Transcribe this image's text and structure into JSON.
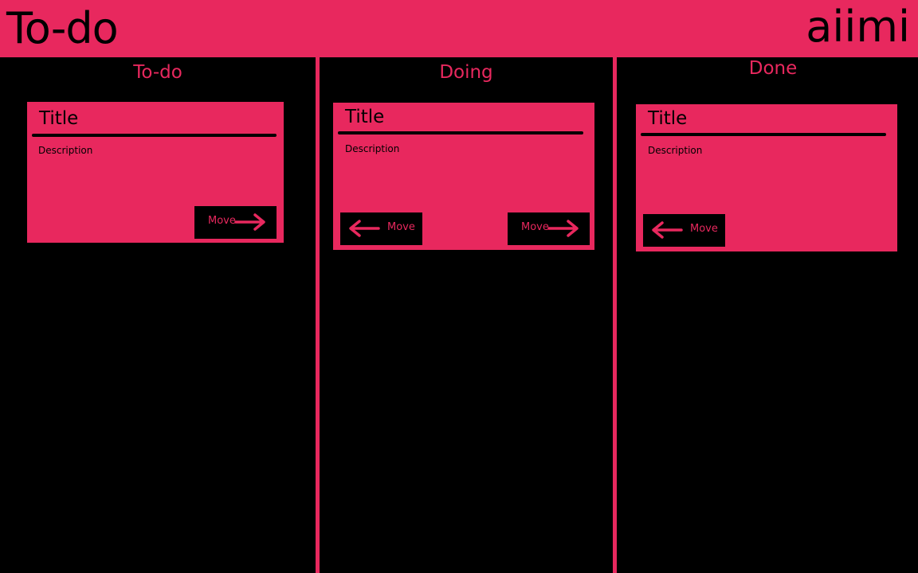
{
  "header": {
    "title": "To-do",
    "brand": "aiimi"
  },
  "colors": {
    "accent": "#e8285e",
    "background": "#000000"
  },
  "columns": [
    {
      "heading": "To-do",
      "card": {
        "title": "Title",
        "description": "Description",
        "buttons": [
          {
            "label": "Move",
            "icon": "arrow-right-icon"
          }
        ]
      }
    },
    {
      "heading": "Doing",
      "card": {
        "title": "Title",
        "description": "Description",
        "buttons": [
          {
            "label": "Move",
            "icon": "arrow-left-icon"
          },
          {
            "label": "Move",
            "icon": "arrow-right-icon"
          }
        ]
      }
    },
    {
      "heading": "Done",
      "card": {
        "title": "Title",
        "description": "Description",
        "buttons": [
          {
            "label": "Move",
            "icon": "arrow-left-icon"
          }
        ]
      }
    }
  ]
}
